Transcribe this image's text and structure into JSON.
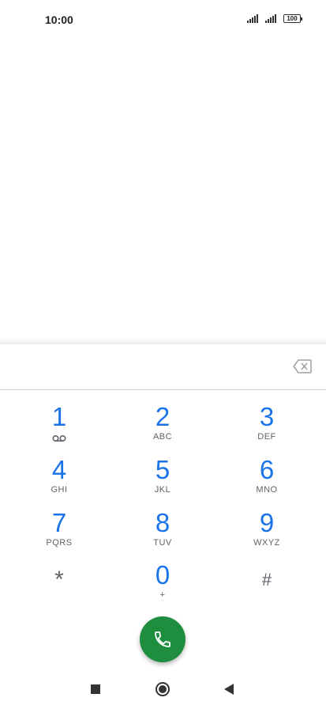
{
  "status_bar": {
    "time": "10:00",
    "battery_level": "100",
    "signal_icons": [
      "signal-1-icon",
      "signal-2-icon"
    ]
  },
  "dialer": {
    "input_value": "",
    "backspace_icon": "backspace-icon",
    "keys": [
      {
        "digit": "1",
        "letters": "",
        "icon": "voicemail-icon"
      },
      {
        "digit": "2",
        "letters": "ABC"
      },
      {
        "digit": "3",
        "letters": "DEF"
      },
      {
        "digit": "4",
        "letters": "GHI"
      },
      {
        "digit": "5",
        "letters": "JKL"
      },
      {
        "digit": "6",
        "letters": "MNO"
      },
      {
        "digit": "7",
        "letters": "PQRS"
      },
      {
        "digit": "8",
        "letters": "TUV"
      },
      {
        "digit": "9",
        "letters": "WXYZ"
      },
      {
        "digit": "*",
        "letters": ""
      },
      {
        "digit": "0",
        "letters": "+"
      },
      {
        "digit": "#",
        "letters": ""
      }
    ],
    "call_icon": "phone-icon",
    "accent_color": "#1a73e8",
    "call_color": "#1e8e3e"
  },
  "nav_bar": {
    "icons": [
      "recents-icon",
      "home-icon",
      "back-icon"
    ]
  }
}
